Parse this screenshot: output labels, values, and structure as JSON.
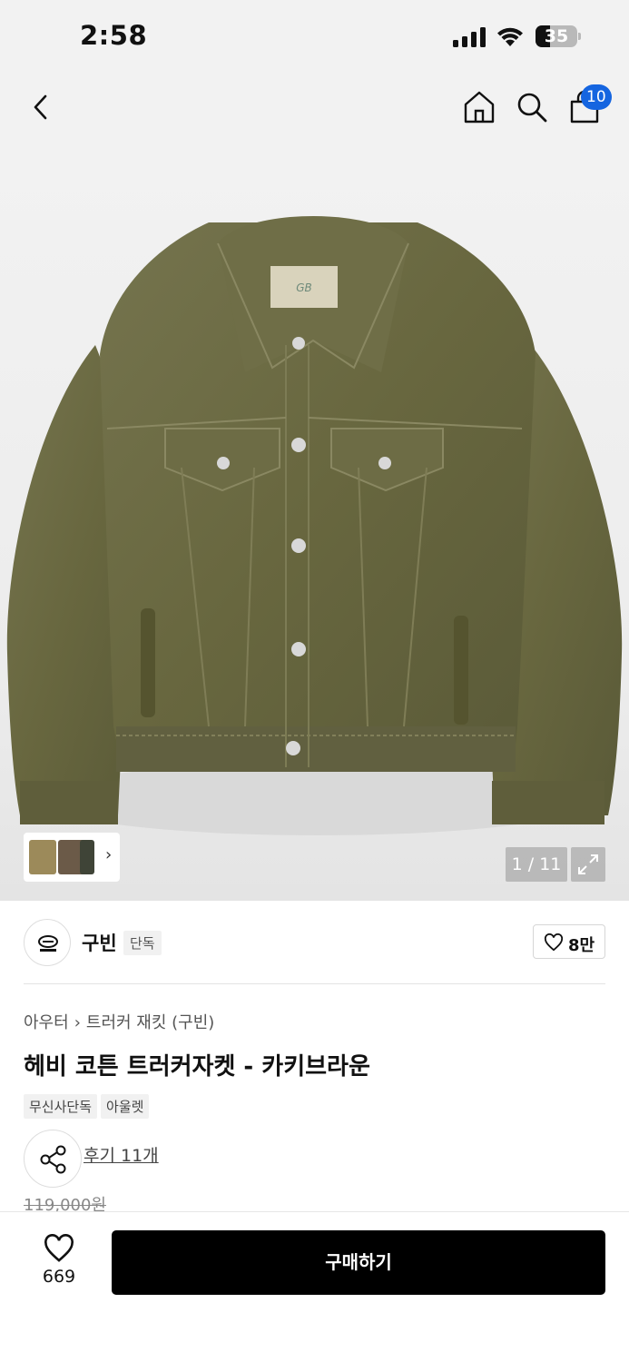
{
  "status_bar": {
    "time": "2:58",
    "battery": "35",
    "battery_level": 0.35
  },
  "nav": {
    "back_icon": "chevron-left-icon",
    "home_icon": "home-icon",
    "search_icon": "search-icon",
    "cart_icon": "shopping-bag-icon",
    "cart_badge": "10",
    "badge_color": "#1565e0"
  },
  "gallery": {
    "counter": "1 / 11",
    "expand_icon": "expand-icon",
    "thumb_arrow": "›",
    "product_color": "#6b6a45"
  },
  "brand": {
    "name": "구빈",
    "tag": "단독",
    "like_count": "8만"
  },
  "product": {
    "breadcrumb": [
      "아우터",
      "트러커 재킷 (구빈)"
    ],
    "title": "헤비 코튼 트러커자켓 - 카키브라운",
    "tags": [
      "무신사단독",
      "아울렛"
    ],
    "review_link": "후기 11개",
    "original_price": "119,000원"
  },
  "bottom_bar": {
    "wish_count": "669",
    "buy_label": "구매하기"
  }
}
